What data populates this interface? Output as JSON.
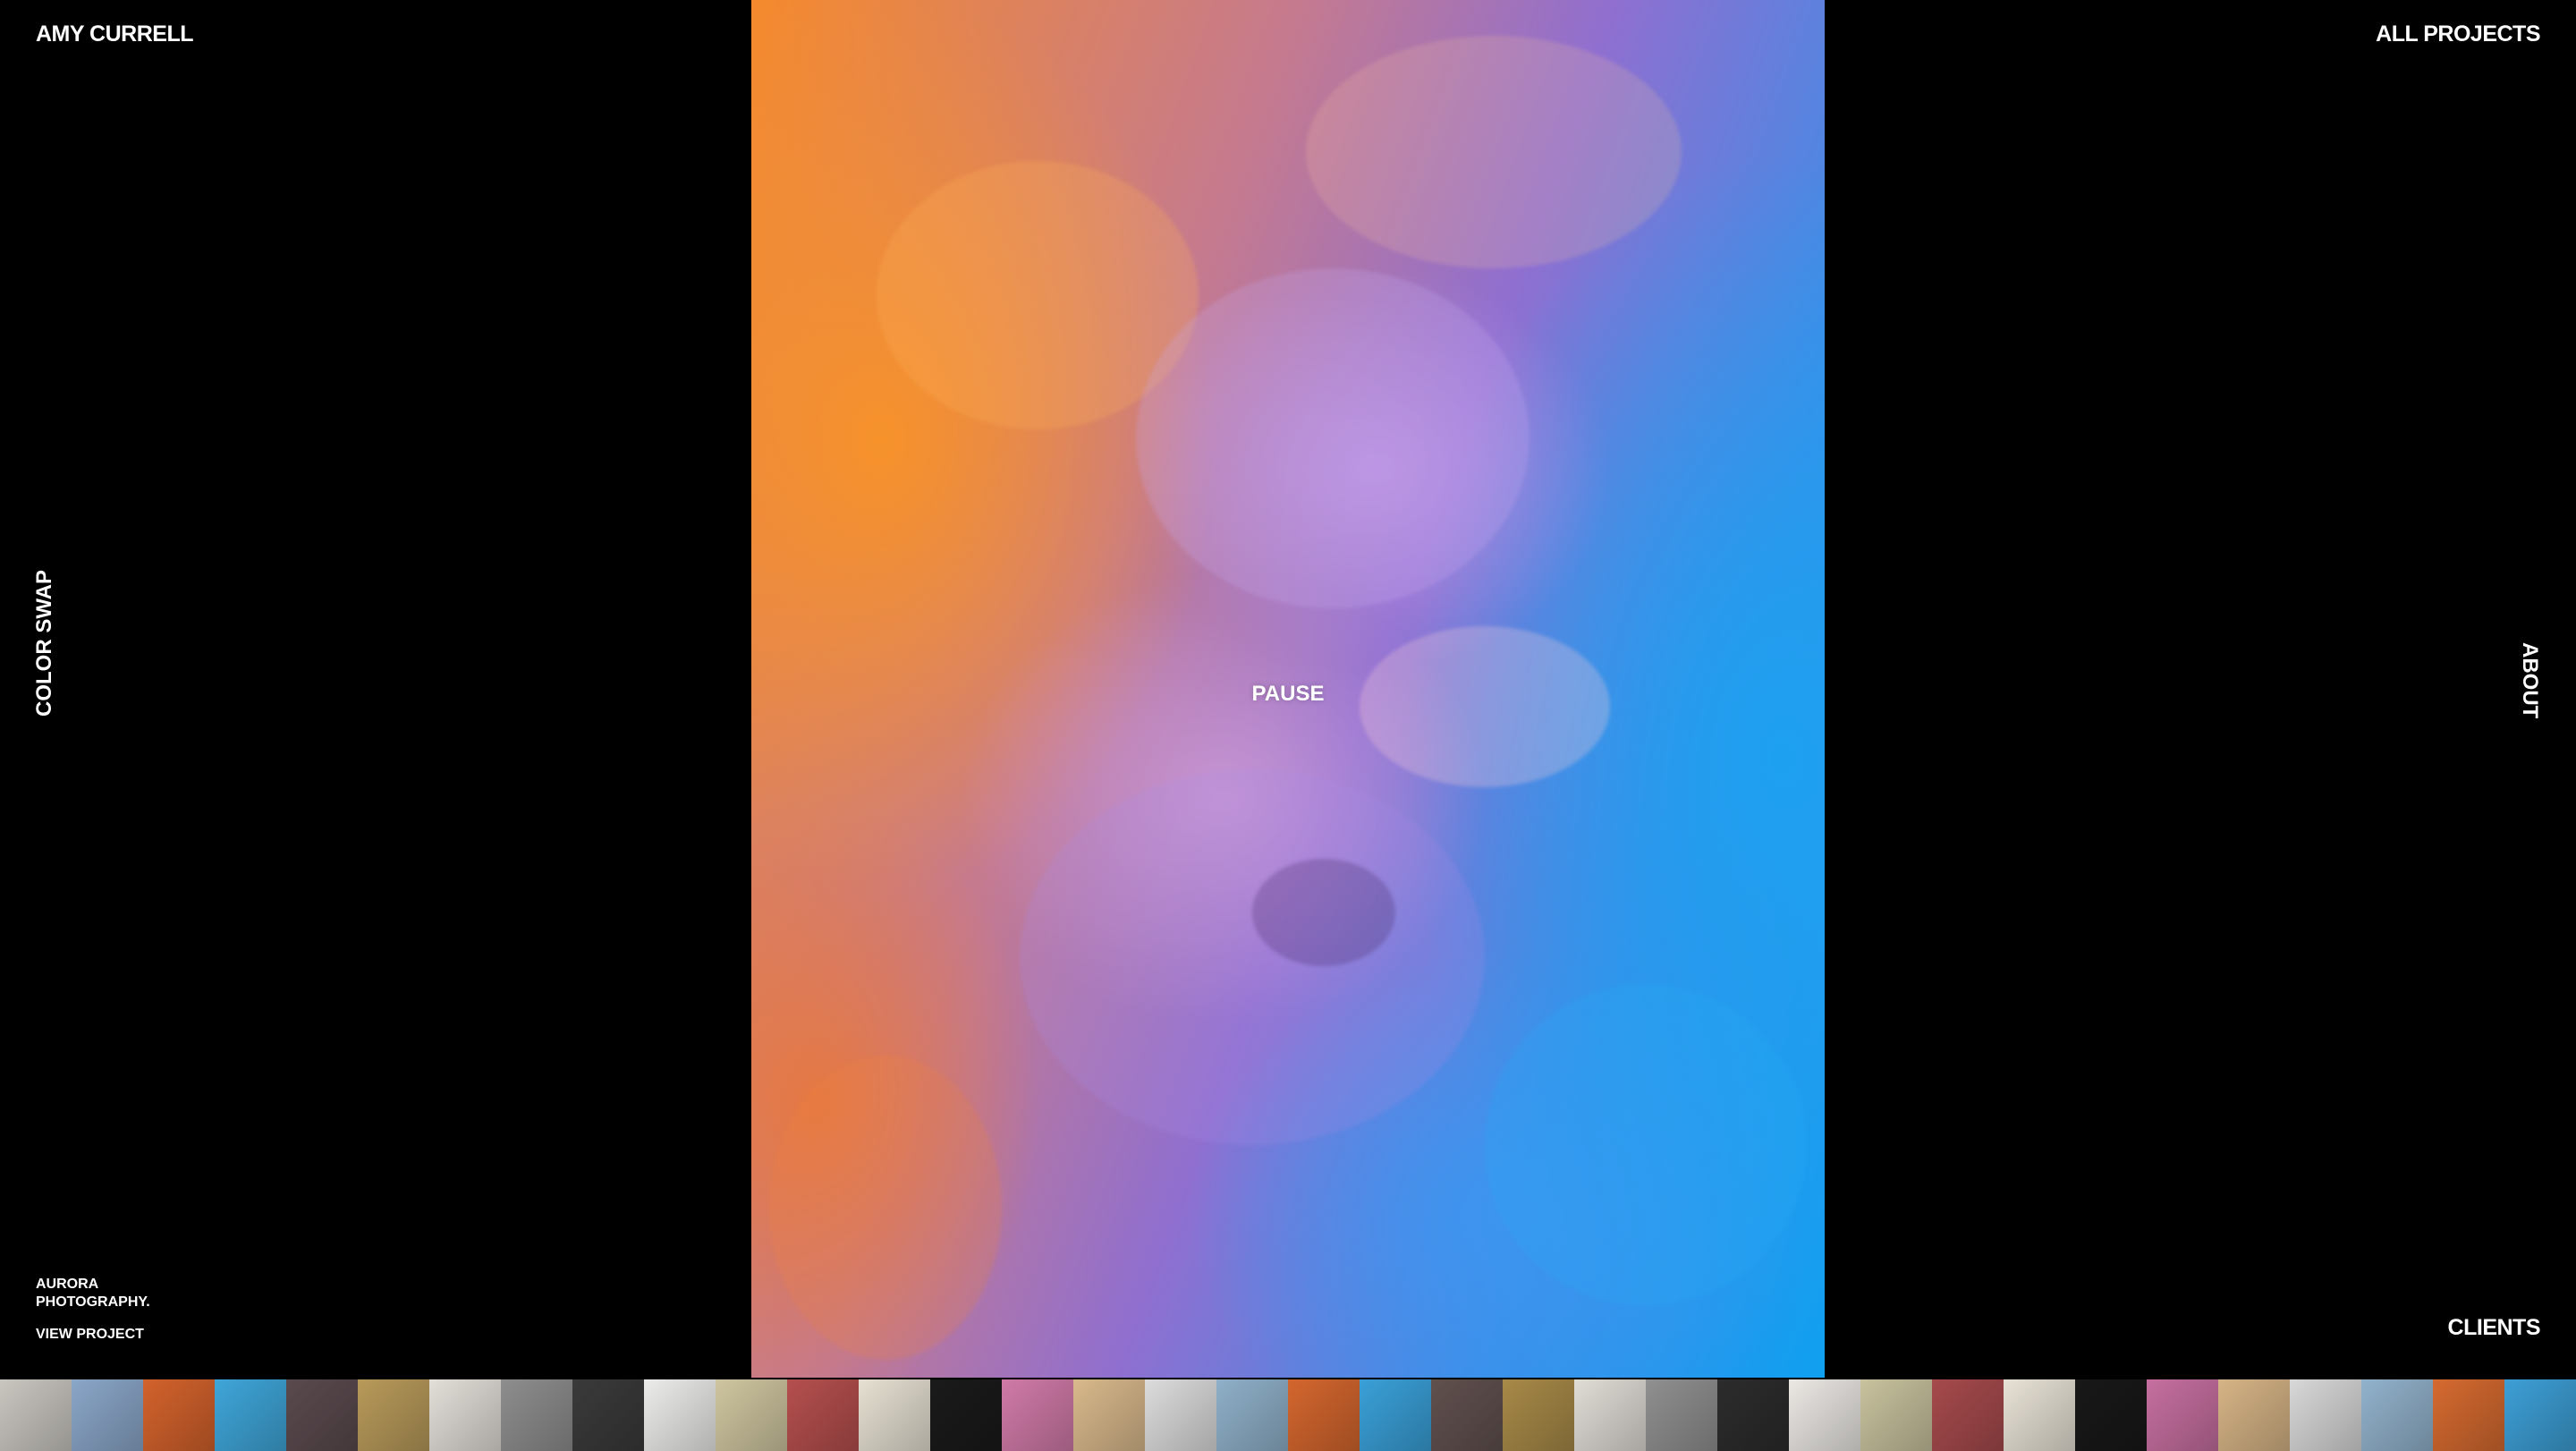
{
  "header": {
    "brand": "AMY CURRELL",
    "all_projects": "ALL PROJECTS"
  },
  "side": {
    "left": "COLOR SWAP",
    "right": "ABOUT"
  },
  "project": {
    "name": "AURORA PHOTOGRAPHY.",
    "view": "VIEW PROJECT"
  },
  "hero": {
    "control": "PAUSE",
    "colors": {
      "warm": "#f7922a",
      "mid": "#9a7ad6",
      "cool": "#1ea0f0"
    }
  },
  "footer": {
    "clients": "CLIENTS"
  },
  "thumbnails": [
    "#c9c6c0",
    "#8aa6c8",
    "#d3622c",
    "#3fa6d9",
    "#5a4a4e",
    "#b89a5a",
    "#e2ded8",
    "#8e8e8e",
    "#3a3a3a",
    "#ececea",
    "#cfc6a0",
    "#b54f4e",
    "#e6e0d2",
    "#1a1a1a",
    "#d07aa8",
    "#d9b98c",
    "#dcdcdc",
    "#8fb0c9",
    "#d4662e",
    "#3aa0d8",
    "#60504e",
    "#a88a48",
    "#e0dcd6",
    "#909090",
    "#2c2c2c",
    "#ebe8e4",
    "#c8c29e",
    "#a64a4c",
    "#e8e2d6",
    "#181818",
    "#c66fa0",
    "#d6b486",
    "#d8d8d8",
    "#92b2cc",
    "#d56a30",
    "#3d9fd6"
  ]
}
